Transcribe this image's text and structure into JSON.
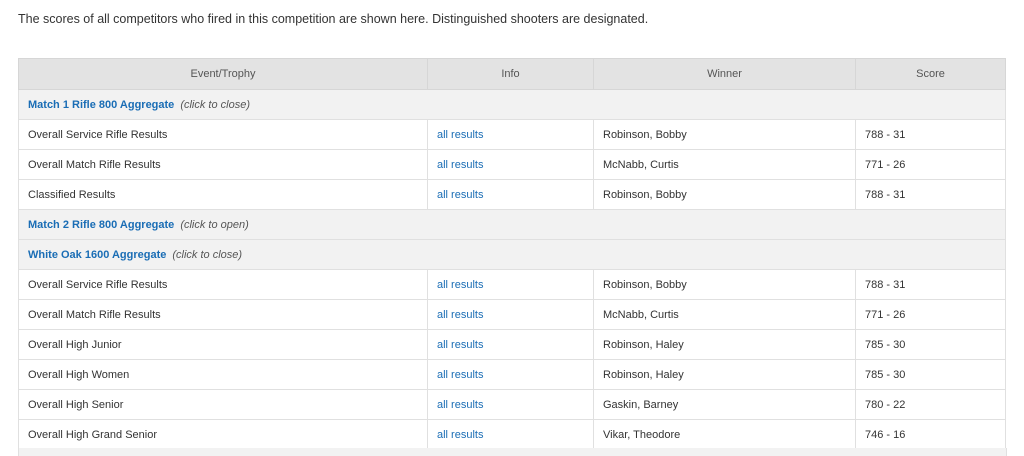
{
  "intro_text": "The scores of all competitors who fired in this competition are shown here. Distinguished shooters are designated.",
  "table": {
    "headers": [
      "Event/Trophy",
      "Info",
      "Winner",
      "Score"
    ],
    "groups": [
      {
        "name": "Match 1 Rifle 800 Aggregate",
        "hint": "(click to close)",
        "rows": [
          {
            "event": "Overall Service Rifle Results",
            "info": "all results",
            "winner": "Robinson, Bobby",
            "score": "788 - 31"
          },
          {
            "event": "Overall Match Rifle Results",
            "info": "all results",
            "winner": "McNabb, Curtis",
            "score": "771 - 26"
          },
          {
            "event": "Classified Results",
            "info": "all results",
            "winner": "Robinson, Bobby",
            "score": "788 - 31"
          }
        ]
      },
      {
        "name": "Match 2 Rifle 800 Aggregate",
        "hint": "(click to open)",
        "rows": []
      },
      {
        "name": "White Oak 1600 Aggregate",
        "hint": "(click to close)",
        "rows": [
          {
            "event": "Overall Service Rifle Results",
            "info": "all results",
            "winner": "Robinson, Bobby",
            "score": "788 - 31"
          },
          {
            "event": "Overall Match Rifle Results",
            "info": "all results",
            "winner": "McNabb, Curtis",
            "score": "771 - 26"
          },
          {
            "event": "Overall High Junior",
            "info": "all results",
            "winner": "Robinson, Haley",
            "score": "785 - 30"
          },
          {
            "event": "Overall High Women",
            "info": "all results",
            "winner": "Robinson, Haley",
            "score": "785 - 30"
          },
          {
            "event": "Overall High Senior",
            "info": "all results",
            "winner": "Gaskin, Barney",
            "score": "780 - 22"
          },
          {
            "event": "Overall High Grand Senior",
            "info": "all results",
            "winner": "Vikar, Theodore",
            "score": "746 - 16"
          }
        ]
      }
    ]
  },
  "colors": {
    "link": "#1a6db5",
    "header_bg": "#e3e3e3",
    "group_bg": "#f2f2f2"
  }
}
